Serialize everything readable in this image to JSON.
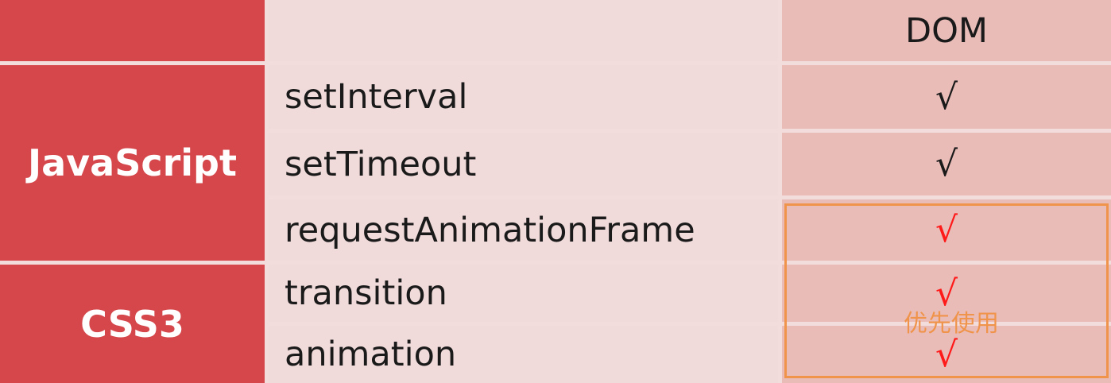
{
  "header": {
    "col_dom": "DOM"
  },
  "groups": [
    {
      "label": "JavaScript"
    },
    {
      "label": "CSS3"
    }
  ],
  "rows": [
    {
      "method": "setInterval",
      "dom": "√",
      "dom_color": "#1a1a1a"
    },
    {
      "method": "setTimeout",
      "dom": "√",
      "dom_color": "#1a1a1a"
    },
    {
      "method": "requestAnimationFrame",
      "dom": "√",
      "dom_color": "#ff1a1a"
    },
    {
      "method": "transition",
      "dom": "√",
      "dom_color": "#ff1a1a"
    },
    {
      "method": "animation",
      "dom": "√",
      "dom_color": "#ff1a1a"
    }
  ],
  "annotation": {
    "text": "优先使用",
    "color": "#f0944b"
  },
  "colors": {
    "group_bg": "#d5474b",
    "method_bg": "#f1dbda",
    "dom_bg": "#e9bcb8"
  }
}
